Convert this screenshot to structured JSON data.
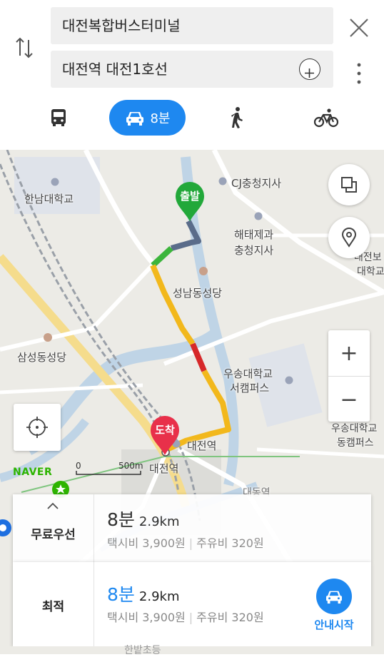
{
  "route": {
    "origin": "대전복합버스터미널",
    "destination": "대전역 대전1호선"
  },
  "modes": {
    "car_label": "8분"
  },
  "map": {
    "labels": {
      "cj": "CJ충청지사",
      "hannam": "한남대학교",
      "haetae": "해태제과\n충청지사",
      "haetae1": "해태제과",
      "haetae2": "충청지사",
      "seongnam": "성남동성당",
      "samseong": "삼성동성당",
      "usong1": "우송대학교",
      "usong2": "서캠퍼스",
      "daejeon_station_a": "대전역",
      "daejeon_station_b": "대전역",
      "right_top1": "대전보",
      "right_top2": "대학교",
      "right_mid1": "우송대학교",
      "right_mid2": "동캠퍼스",
      "daedong": "대동역",
      "hanbat": "한밭초등"
    },
    "pins": {
      "start": "출발",
      "end": "도착"
    },
    "naver": "NAVER",
    "scale": {
      "zero": "0",
      "value": "500m"
    },
    "zoom_in": "+",
    "zoom_out": "−"
  },
  "results": [
    {
      "option": "무료우선",
      "time": "8분",
      "distance": "2.9km",
      "taxi": "택시비 3,900원",
      "fuel": "주유비 320원"
    },
    {
      "option": "최적",
      "time": "8분",
      "distance": "2.9km",
      "taxi": "택시비 3,900원",
      "fuel": "주유비 320원",
      "start_nav": "안내시작"
    }
  ],
  "colors": {
    "accent": "#1e88f0",
    "start_pin": "#22a83a",
    "end_pin": "#e8304a",
    "route_green": "#3cb53c",
    "route_yellow": "#f2b81c",
    "route_red": "#d6282a",
    "route_gray": "#5a6c8a"
  }
}
